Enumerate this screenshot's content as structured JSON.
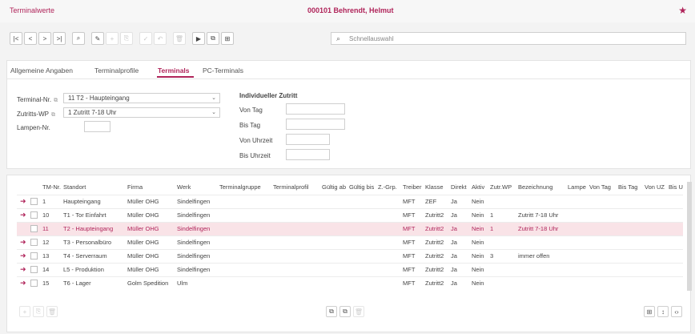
{
  "window": {
    "title_left": "Terminalwerte",
    "title_center": "000101  Behrendt, Helmut",
    "star": "★"
  },
  "toolbar": {
    "first": "|<",
    "prev": "<",
    "next": ">",
    "last": ">|",
    "search": "⌕",
    "edit": "✎",
    "add": "+",
    "copy": "⎘",
    "ok": "✓",
    "undo": "↶",
    "delete": "🗑",
    "play": "▶",
    "docs": "⧉",
    "report": "⊞",
    "search_placeholder": "Schnellauswahl"
  },
  "tabs": [
    "Allgemeine Angaben",
    "Terminalprofile",
    "Terminals",
    "PC-Terminals"
  ],
  "form": {
    "terminal_label": "Terminal-Nr.",
    "terminal_value": "11 T2 - Haupteingang",
    "zutritts_label": "Zutritts-WP",
    "zutritts_value": "1 Zutritt 7-18 Uhr",
    "lampen_label": "Lampen-Nr.",
    "ind_title": "Individueller Zutritt",
    "von_tag": "Von Tag",
    "bis_tag": "Bis Tag",
    "von_uhrzeit": "Von Uhrzeit",
    "bis_uhrzeit": "Bis Uhrzeit",
    "ext_icon": "⧉",
    "arrow": "⌄"
  },
  "grid": {
    "headers": [
      "TM-Nr.",
      "Standort",
      "Firma",
      "Werk",
      "Terminalgruppe",
      "Terminalprofil",
      "Gültig ab",
      "Gültig bis",
      "Z.-Grp.",
      "Treiber",
      "Klasse",
      "Direkt",
      "Aktiv",
      "Zutr.WP",
      "Bezeichnung",
      "Lampe",
      "Von Tag",
      "Bis Tag",
      "Von UZ",
      "Bis U"
    ],
    "rows": [
      {
        "nr": "1",
        "standort": "Haupteingang",
        "firma": "Müller OHG",
        "werk": "Sindelfingen",
        "treiber": "MFT",
        "klasse": "ZEF",
        "direkt": "Ja",
        "aktiv": "Nein",
        "zutrwp": "",
        "bez": "",
        "arrow": true,
        "selected": false
      },
      {
        "nr": "10",
        "standort": "T1 - Tor Einfahrt",
        "firma": "Müller OHG",
        "werk": "Sindelfingen",
        "treiber": "MFT",
        "klasse": "Zutritt2",
        "direkt": "Ja",
        "aktiv": "Nein",
        "zutrwp": "1",
        "bez": "Zutritt 7-18 Uhr",
        "arrow": true,
        "selected": false
      },
      {
        "nr": "11",
        "standort": "T2 - Haupteingang",
        "firma": "Müller OHG",
        "werk": "Sindelfingen",
        "treiber": "MFT",
        "klasse": "Zutritt2",
        "direkt": "Ja",
        "aktiv": "Nein",
        "zutrwp": "1",
        "bez": "Zutritt 7-18 Uhr",
        "arrow": false,
        "selected": true
      },
      {
        "nr": "12",
        "standort": "T3 - Personalbüro",
        "firma": "Müller OHG",
        "werk": "Sindelfingen",
        "treiber": "MFT",
        "klasse": "Zutritt2",
        "direkt": "Ja",
        "aktiv": "Nein",
        "zutrwp": "",
        "bez": "",
        "arrow": true,
        "selected": false
      },
      {
        "nr": "13",
        "standort": "T4 - Serverraum",
        "firma": "Müller OHG",
        "werk": "Sindelfingen",
        "treiber": "MFT",
        "klasse": "Zutritt2",
        "direkt": "Ja",
        "aktiv": "Nein",
        "zutrwp": "3",
        "bez": "immer offen",
        "arrow": true,
        "selected": false
      },
      {
        "nr": "14",
        "standort": "L5 - Produktion",
        "firma": "Müller OHG",
        "werk": "Sindelfingen",
        "treiber": "MFT",
        "klasse": "Zutritt2",
        "direkt": "Ja",
        "aktiv": "Nein",
        "zutrwp": "",
        "bez": "",
        "arrow": true,
        "selected": false
      },
      {
        "nr": "15",
        "standort": "T6 - Lager",
        "firma": "Golm Spedition",
        "werk": "Ulm",
        "treiber": "MFT",
        "klasse": "Zutritt2",
        "direkt": "Ja",
        "aktiv": "Nein",
        "zutrwp": "",
        "bez": "",
        "arrow": true,
        "selected": false
      }
    ]
  },
  "bottom": {
    "add": "+",
    "copy": "⎘",
    "delete": "🗑",
    "b1": "⧉",
    "b2": "⧉",
    "b3": "🗑",
    "r1": "⊞",
    "r2": "↕",
    "r3": "‹›"
  }
}
